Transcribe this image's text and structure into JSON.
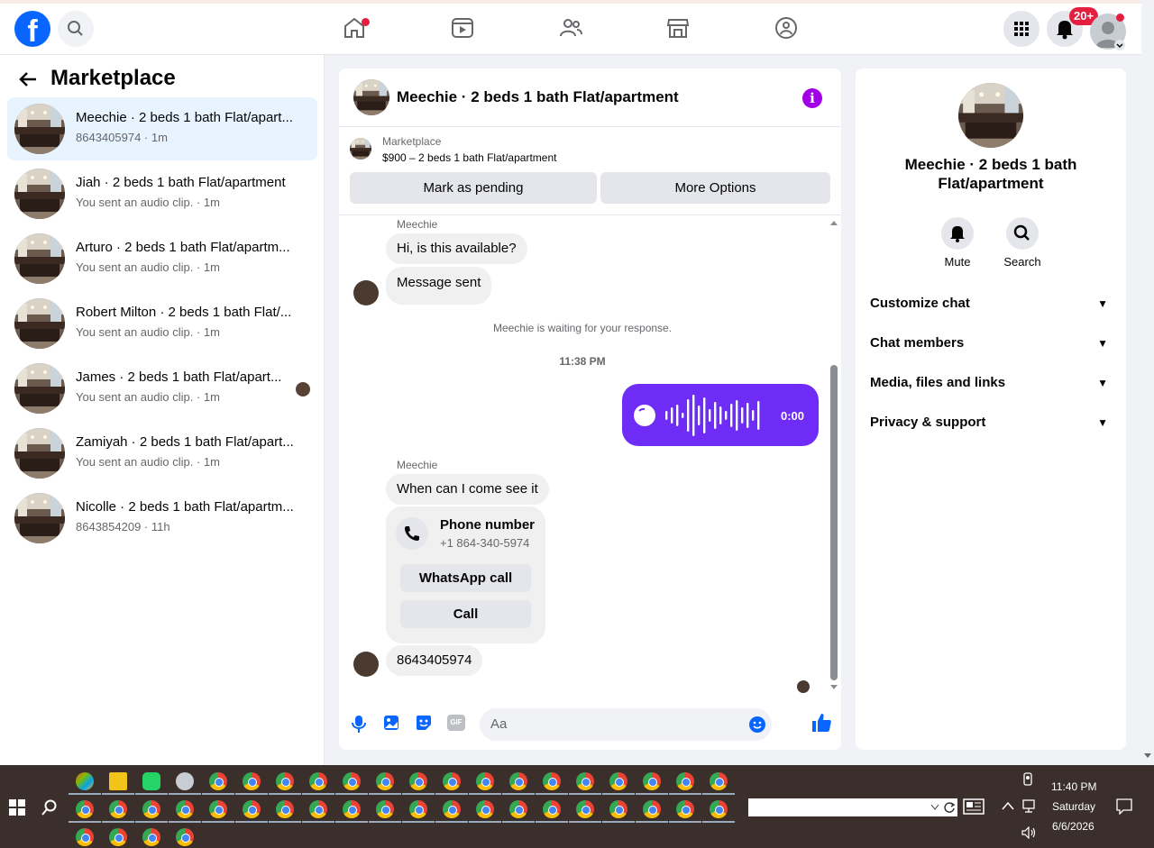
{
  "topbar": {
    "logo_letter": "f",
    "notification_badge": "20+",
    "nav_icons": [
      "home-icon",
      "video-icon",
      "friends-icon",
      "marketplace-icon",
      "groups-icon"
    ]
  },
  "sidebar": {
    "title": "Marketplace",
    "conversations": [
      {
        "title": "Meechie · 2 beds 1 bath Flat/apart...",
        "subtitle": "8643405974 · 1m",
        "active": true
      },
      {
        "title": "Jiah · 2 beds 1 bath Flat/apartment",
        "subtitle": "You sent an audio clip. · 1m"
      },
      {
        "title": "Arturo · 2 beds 1 bath Flat/apartm...",
        "subtitle": "You sent an audio clip. · 1m"
      },
      {
        "title": "Robert Milton · 2 beds 1 bath Flat/...",
        "subtitle": "You sent an audio clip. · 1m"
      },
      {
        "title": "James · 2 beds 1 bath Flat/apart...",
        "subtitle": "You sent an audio clip. · 1m"
      },
      {
        "title": "Zamiyah · 2 beds 1 bath Flat/apart...",
        "subtitle": "You sent an audio clip. · 1m"
      },
      {
        "title": "Nicolle · 2 beds 1 bath Flat/apartm...",
        "subtitle": "8643854209 · 11h"
      }
    ]
  },
  "chat": {
    "title": "Meechie · 2 beds 1 bath Flat/apartment",
    "marketplace_label": "Marketplace",
    "listing": "$900 – 2 beds 1 bath Flat/apartment",
    "mark_pending": "Mark as pending",
    "more_options": "More Options",
    "sender_name": "Meechie",
    "msg1": "Hi, is this available?",
    "msg2": "Message sent",
    "waiting_note": "Meechie is waiting for your response.",
    "timestamp": "11:38 PM",
    "audio_duration": "0:00",
    "msg3": "When can I come see it",
    "phone_title": "Phone number",
    "phone_number": "+1 864-340-5974",
    "whatsapp_call": "WhatsApp call",
    "call": "Call",
    "msg4": "8643405974",
    "compose_placeholder": "Aa",
    "gif_label": "GIF"
  },
  "right_panel": {
    "title": "Meechie · 2 beds 1 bath Flat/apartment",
    "mute": "Mute",
    "search": "Search",
    "rows": [
      "Customize chat",
      "Chat members",
      "Media, files and links",
      "Privacy & support"
    ]
  },
  "taskbar": {
    "time": "11:40 PM",
    "day": "Saturday",
    "date": "6/6/2026"
  },
  "colors": {
    "accent": "#0866ff",
    "audio_bubble": "#6e2cf6",
    "info": "#a100e6"
  }
}
